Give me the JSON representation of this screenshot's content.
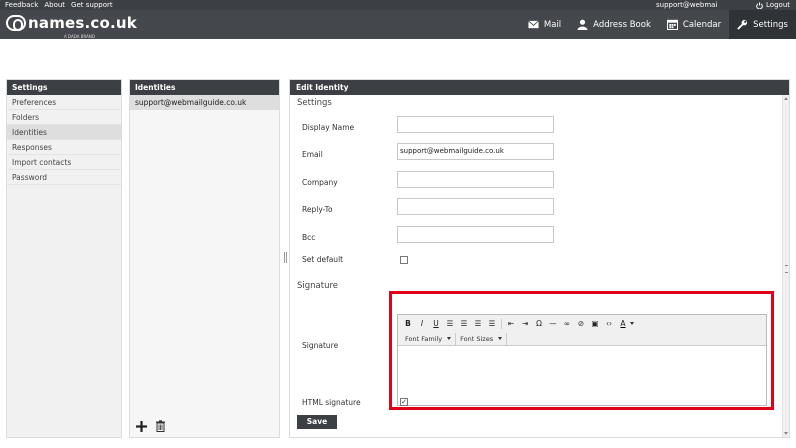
{
  "topbar": {
    "feedback": "Feedback",
    "about": "About",
    "support": "Get support",
    "user": "support@webmailg",
    "logout": "Logout"
  },
  "brand": {
    "name": "names.co.uk",
    "tagline": "A DADA BRAND"
  },
  "nav": [
    {
      "label": "Mail",
      "icon": "envelope-icon"
    },
    {
      "label": "Address Book",
      "icon": "person-icon"
    },
    {
      "label": "Calendar",
      "icon": "calendar-icon"
    },
    {
      "label": "Settings",
      "icon": "wrench-icon",
      "active": true
    }
  ],
  "settings": {
    "title": "Settings",
    "items": [
      "Preferences",
      "Folders",
      "Identities",
      "Responses",
      "Import contacts",
      "Password"
    ],
    "selected": "Identities"
  },
  "identities": {
    "title": "Identities",
    "items": [
      "support@webmailguide.co.uk"
    ]
  },
  "edit": {
    "title": "Edit Identity",
    "settings_section": "Settings",
    "display_name_label": "Display Name",
    "display_name_value": "",
    "email_label": "Email",
    "email_value": "support@webmailguide.co.uk",
    "company_label": "Company",
    "company_value": "",
    "replyto_label": "Reply-To",
    "replyto_value": "",
    "bcc_label": "Bcc",
    "bcc_value": "",
    "set_default_label": "Set default",
    "signature_section": "Signature",
    "signature_label": "Signature",
    "html_signature_label": "HTML signature",
    "html_signature_check": "✓",
    "font_family": "Font Family",
    "font_sizes": "Font Sizes",
    "save": "Save"
  },
  "colors": {
    "header": "#44474c",
    "highlight": "#e1001a"
  }
}
